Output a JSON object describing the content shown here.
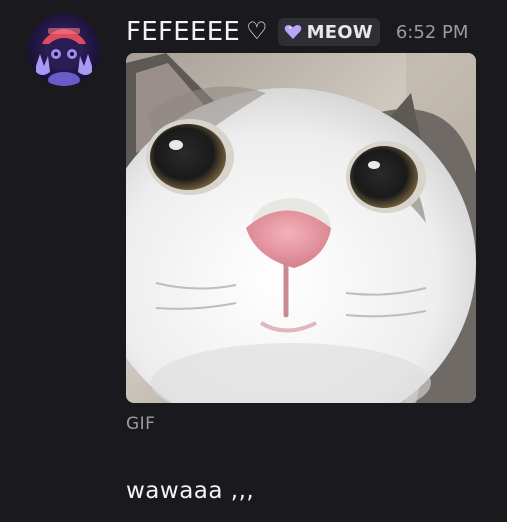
{
  "message": {
    "author": {
      "username": "FEFEEEE",
      "decoration": "♡",
      "avatar_icon": "avatar-purple-character"
    },
    "tag": {
      "icon": "heart-gem-icon",
      "label": "MEOW"
    },
    "timestamp": "6:52 PM",
    "attachment": {
      "kind": "cat-face-gif",
      "label": "GIF"
    },
    "text": "wawaaa ,,,"
  },
  "colors": {
    "background": "#1a1a1e",
    "text_primary": "#f2f3f5",
    "text_muted": "#9a9ba2",
    "tag_background": "#2e2f35",
    "tag_icon": "#b9a4f5"
  }
}
